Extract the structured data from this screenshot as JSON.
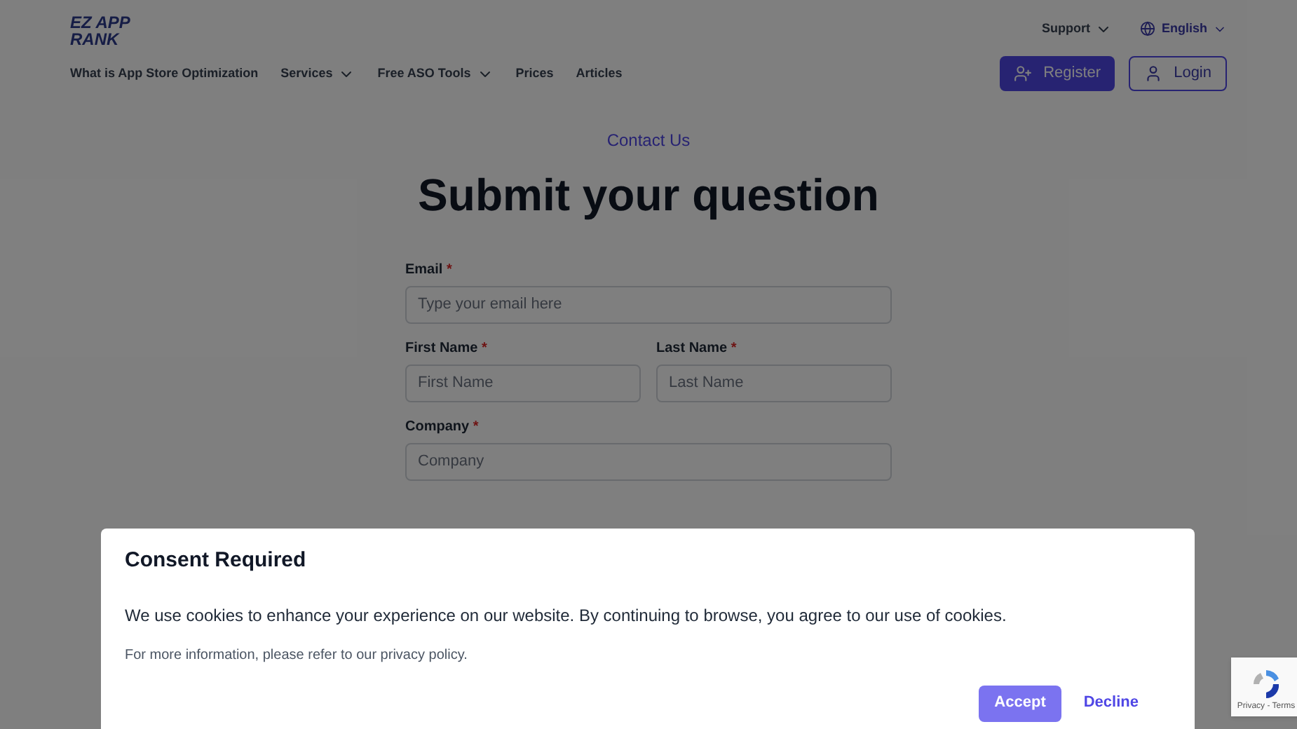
{
  "logo": {
    "line1": "EZ APP",
    "line2": "RANK"
  },
  "nav": [
    {
      "label": "What is App Store Optimization",
      "kind": "link"
    },
    {
      "label": "Services",
      "kind": "dropdown"
    },
    {
      "label": "Free ASO Tools",
      "kind": "dropdown"
    },
    {
      "label": "Prices",
      "kind": "link"
    },
    {
      "label": "Articles",
      "kind": "link"
    }
  ],
  "top_links": {
    "support": "Support",
    "language": "English"
  },
  "buttons": {
    "register": "Register",
    "login": "Login"
  },
  "eyebrow": "Contact Us",
  "heading": "Submit your question",
  "form": [
    [
      {
        "label": "Email",
        "required_mark": "*",
        "placeholder": "Type your email here"
      }
    ],
    [
      {
        "label": "First Name",
        "required_mark": "*",
        "placeholder": "First Name"
      },
      {
        "label": "Last Name",
        "required_mark": "*",
        "placeholder": "Last Name"
      }
    ],
    [
      {
        "label": "Company",
        "required_mark": "*",
        "placeholder": "Company"
      }
    ]
  ],
  "consent": {
    "title": "Consent Required",
    "message": "We use cookies to enhance your experience on our website. By continuing to browse, you agree to our use of cookies.",
    "note": "For more information, please refer to our privacy policy.",
    "accept": "Accept",
    "decline": "Decline"
  },
  "recaptcha": {
    "links": "Privacy - Terms"
  }
}
